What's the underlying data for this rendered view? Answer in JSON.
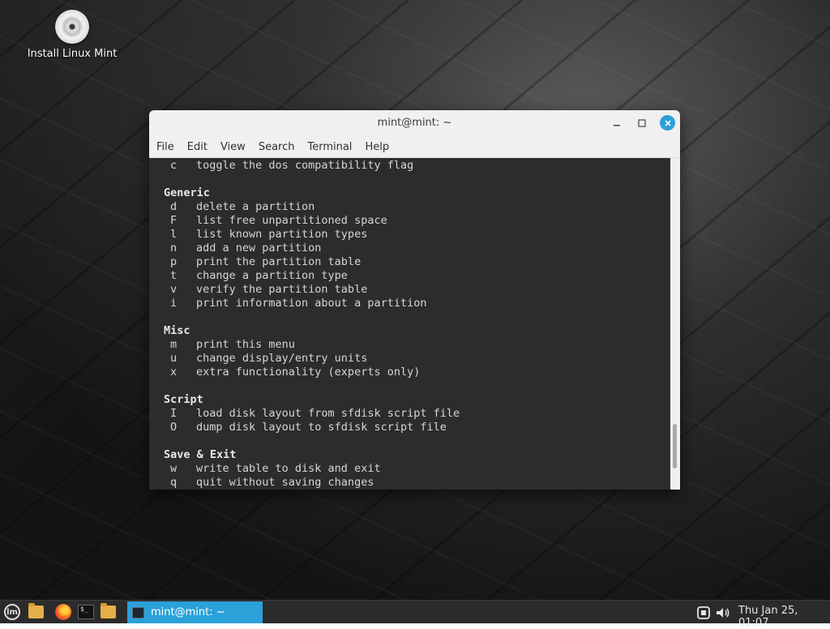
{
  "desktop": {
    "icons": [
      {
        "label": "Install Linux Mint",
        "icon": "disc-icon"
      }
    ]
  },
  "window": {
    "title": "mint@mint: ~",
    "menu": [
      "File",
      "Edit",
      "View",
      "Search",
      "Terminal",
      "Help"
    ],
    "terminal_lines": [
      {
        "type": "cmd",
        "key": "c",
        "desc": "toggle the dos compatibility flag"
      },
      {
        "type": "blank"
      },
      {
        "type": "head",
        "text": "Generic"
      },
      {
        "type": "cmd",
        "key": "d",
        "desc": "delete a partition"
      },
      {
        "type": "cmd",
        "key": "F",
        "desc": "list free unpartitioned space"
      },
      {
        "type": "cmd",
        "key": "l",
        "desc": "list known partition types"
      },
      {
        "type": "cmd",
        "key": "n",
        "desc": "add a new partition"
      },
      {
        "type": "cmd",
        "key": "p",
        "desc": "print the partition table"
      },
      {
        "type": "cmd",
        "key": "t",
        "desc": "change a partition type"
      },
      {
        "type": "cmd",
        "key": "v",
        "desc": "verify the partition table"
      },
      {
        "type": "cmd",
        "key": "i",
        "desc": "print information about a partition"
      },
      {
        "type": "blank"
      },
      {
        "type": "head",
        "text": "Misc"
      },
      {
        "type": "cmd",
        "key": "m",
        "desc": "print this menu"
      },
      {
        "type": "cmd",
        "key": "u",
        "desc": "change display/entry units"
      },
      {
        "type": "cmd",
        "key": "x",
        "desc": "extra functionality (experts only)"
      },
      {
        "type": "blank"
      },
      {
        "type": "head",
        "text": "Script"
      },
      {
        "type": "cmd",
        "key": "I",
        "desc": "load disk layout from sfdisk script file"
      },
      {
        "type": "cmd",
        "key": "O",
        "desc": "dump disk layout to sfdisk script file"
      },
      {
        "type": "blank"
      },
      {
        "type": "head",
        "text": "Save & Exit"
      },
      {
        "type": "cmd",
        "key": "w",
        "desc": "write table to disk and exit"
      },
      {
        "type": "cmd",
        "key": "q",
        "desc": "quit without saving changes"
      }
    ]
  },
  "taskbar": {
    "active_task": "mint@mint: ~",
    "clock": "Thu Jan 25, 01:07",
    "launchers": [
      "menu-icon",
      "files-icon",
      "firefox-icon",
      "terminal-icon",
      "folder-icon"
    ]
  },
  "colors": {
    "accent": "#2aa1d9",
    "terminal_bg": "#2c2c2c",
    "terminal_fg": "#d6d6d6"
  }
}
